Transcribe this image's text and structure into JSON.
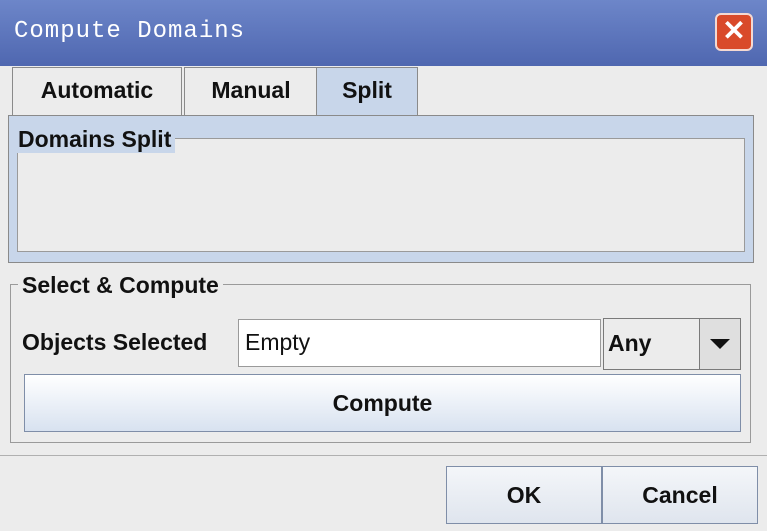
{
  "window": {
    "title": "Compute Domains"
  },
  "tabs": [
    {
      "label": "Automatic"
    },
    {
      "label": "Manual"
    },
    {
      "label": "Split",
      "selected": true
    }
  ],
  "split_panel": {
    "group_label": "Domains Split"
  },
  "select_compute": {
    "group_label": "Select & Compute",
    "objects_label": "Objects Selected",
    "objects_value": "Empty",
    "filter_value": "Any",
    "compute_label": "Compute"
  },
  "footer": {
    "ok_label": "OK",
    "cancel_label": "Cancel"
  },
  "colors": {
    "title_bar": "#5a72bb",
    "selected_tab": "#c8d6ea",
    "close_button": "#d94a2a"
  }
}
